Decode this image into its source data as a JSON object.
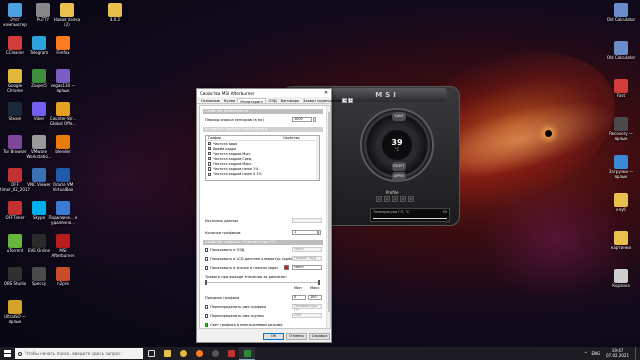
{
  "desktop": {
    "icons_left": [
      {
        "label": "Этот компьютер",
        "color": "#4aa3e0"
      },
      {
        "label": "PuTTY",
        "color": "#888888"
      },
      {
        "label": "Новая папка (2)",
        "color": "#e8c04c"
      },
      {
        "label": "4.0.2",
        "color": "#e8c04c"
      },
      {
        "label": "CCleaner",
        "color": "#d43b3b"
      },
      {
        "label": "Telegram",
        "color": "#2aa3df"
      },
      {
        "label": "Firefox",
        "color": "#ff7b22"
      },
      {
        "label": "Google Chrome",
        "color": "#e0b83a"
      },
      {
        "label": "Zoiper5",
        "color": "#3e8e3e"
      },
      {
        "label": "vegas130 — ярлык",
        "color": "#7a5cc2"
      },
      {
        "label": "Steam",
        "color": "#1b2838"
      },
      {
        "label": "Viber",
        "color": "#7360f2"
      },
      {
        "label": "Counter-Str... Global Offe...",
        "color": "#e6a022"
      },
      {
        "label": "Tor Browser",
        "color": "#7d4698"
      },
      {
        "label": "VMware Workstatio...",
        "color": "#9a9a9a"
      },
      {
        "label": "blender",
        "color": "#e87d0d"
      },
      {
        "label": "OFF timer_02_2017",
        "color": "#c23232"
      },
      {
        "label": "VNC Viewer",
        "color": "#3a70b5"
      },
      {
        "label": "Oracle VM VirtualBox",
        "color": "#1e5aa8"
      },
      {
        "label": "OFFTimer",
        "color": "#c23232"
      },
      {
        "label": "Skype",
        "color": "#00aff0"
      },
      {
        "label": "Подключе... к удаленно...",
        "color": "#3a7bd5"
      },
      {
        "label": "uTorrent",
        "color": "#69b53b"
      },
      {
        "label": "EVE Online",
        "color": "#2a2a2a"
      },
      {
        "label": "MSI Afterburner",
        "color": "#b81c1c"
      },
      {
        "label": "OBS Studio",
        "color": "#303030"
      },
      {
        "label": "Speccy",
        "color": "#4a4a4a"
      },
      {
        "label": "n2pre",
        "color": "#c84b2a"
      },
      {
        "label": "UltraISO — ярлык",
        "color": "#d4a42a"
      }
    ],
    "icons_right": [
      {
        "label": "Old Calculator",
        "color": "#6a8cc8"
      },
      {
        "label": "Old Calculator",
        "color": "#6a8cc8"
      },
      {
        "label": "Fast",
        "color": "#d43b3b"
      },
      {
        "label": "Recovery — ярлык",
        "color": "#4a4a4a"
      },
      {
        "label": "Загрузки — ярлык",
        "color": "#3a8ad5"
      },
      {
        "label": "клуб",
        "color": "#e8c04c"
      },
      {
        "label": "картинки",
        "color": "#e8c04c"
      },
      {
        "label": "Корзина",
        "color": "#cfcfcf"
      }
    ]
  },
  "afterburner": {
    "brand": "MSI",
    "temp_value": "39",
    "temp_unit": "°C",
    "gauge_btn_top": "SAVE",
    "gauge_btn_mid": "RESET",
    "gauge_btn_bot": "APPLY",
    "profile_label": "Profile",
    "profile_slots": [
      "1",
      "2",
      "3",
      "4",
      "5"
    ],
    "graph_label": "Температура ГП, °C",
    "graph_value": "39"
  },
  "dialog": {
    "title": "Свойства MSI Afterburner",
    "close": "✕",
    "tabs": [
      "Основные",
      "Кулер",
      "Мониторинг",
      "ОЭД",
      "Бенчмарк",
      "Захват скриншотов"
    ],
    "active_tab": "Мониторинг",
    "tab_arrow_left": "◂",
    "tab_arrow_right": "▸",
    "section_monitoring": "Свойства мониторинга",
    "poll_label": "Период опроса сенсоров (в мс)",
    "poll_value": "1000",
    "section_active_graphs": "Активные графики мониторинга",
    "table_head_graph": "График",
    "table_head_props": "Свойства",
    "graphs": [
      "Частота ядра",
      "Время кадра",
      "Частота кадров Мин.",
      "Частота кадров Сред.",
      "Частота кадров Макс.",
      "Частота кадров ниже 1%",
      "Частота кадров ниже 0.1%"
    ],
    "data_source_label": "Источник данных",
    "data_source_value": "",
    "columns_label": "Колонки графиков",
    "columns_value": "1",
    "section_graph_props": "Свойства графика «Температура ГП»",
    "show_osd": "Показывать в ОЭД",
    "show_lcd": "Показывать в LCD дисплее клавиатур Logitech",
    "show_tray": "Показывать в значке в панели задач",
    "osd_value": "текст",
    "lcd_value": "график ЛЦД",
    "tray_value": "текст",
    "alarm_label": "Тревога при выходе значения за диапазон",
    "min_label": "Мин",
    "max_label": "Макс",
    "limits_label": "Пределы графика",
    "limit_min": "0",
    "limit_max": "100",
    "override_name_label": "Переопределить имя графика",
    "override_name_value": "Температура ГП",
    "override_group_label": "Переопределить имя группы",
    "override_group_value": "GPU",
    "separate_mode_label": "Свет графика в многоцелевом режиме",
    "btn_ok": "ОК",
    "btn_cancel": "Отмена",
    "btn_help": "Справка"
  },
  "taskbar": {
    "search_placeholder": "Чтобы начать поиск, введите здесь запрос",
    "tray_lang": "ENG",
    "time": "19:47",
    "date": "07.02.2021"
  }
}
